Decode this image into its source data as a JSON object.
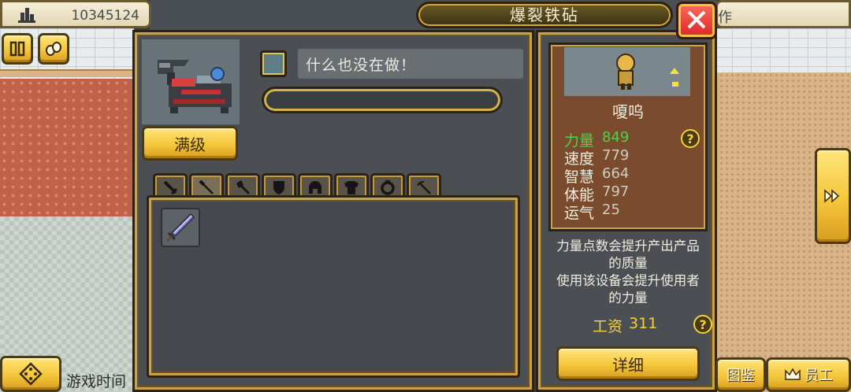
{
  "hud": {
    "money": "10345124",
    "money_icon": "building-icon",
    "game_time_label": "游戏时间"
  },
  "dialog": {
    "title": "爆裂铁砧",
    "close_icon": "close-icon",
    "status_text": "什么也没在做！",
    "max_level_label": "满级",
    "progress": 0,
    "tabs": [
      {
        "icon": "sword-icon",
        "active": false
      },
      {
        "icon": "spear-icon",
        "active": true
      },
      {
        "icon": "axe-icon",
        "active": false
      },
      {
        "icon": "shield-icon",
        "active": false
      },
      {
        "icon": "helmet-icon",
        "active": false
      },
      {
        "icon": "armor-icon",
        "active": false
      },
      {
        "icon": "ring-icon",
        "active": false
      },
      {
        "icon": "pickaxe-icon",
        "active": false
      }
    ],
    "inventory_items": [
      {
        "icon": "dagger-icon"
      }
    ]
  },
  "worker": {
    "name": "嗄呜",
    "stats": [
      {
        "label": "力量",
        "value": "849",
        "highlight": true
      },
      {
        "label": "速度",
        "value": "779",
        "highlight": false
      },
      {
        "label": "智慧",
        "value": "664",
        "highlight": false
      },
      {
        "label": "体能",
        "value": "797",
        "highlight": false
      },
      {
        "label": "运气",
        "value": "25",
        "highlight": false
      }
    ],
    "description": [
      "力量点数会提升产出产品",
      "的质量",
      "使用该设备会提升使用者",
      "的力量"
    ],
    "salary_label": "工资",
    "salary_value": "311",
    "detail_label": "详细"
  },
  "right_buttons": {
    "partial_top": "作",
    "handbook_label": "图鉴",
    "staff_label": "员工"
  },
  "colors": {
    "gold": "#f4c63b",
    "panel": "#4b4f54",
    "highlight_green": "#4cd34c",
    "salary_yellow": "#f3d13a",
    "close_red": "#d8282a"
  }
}
